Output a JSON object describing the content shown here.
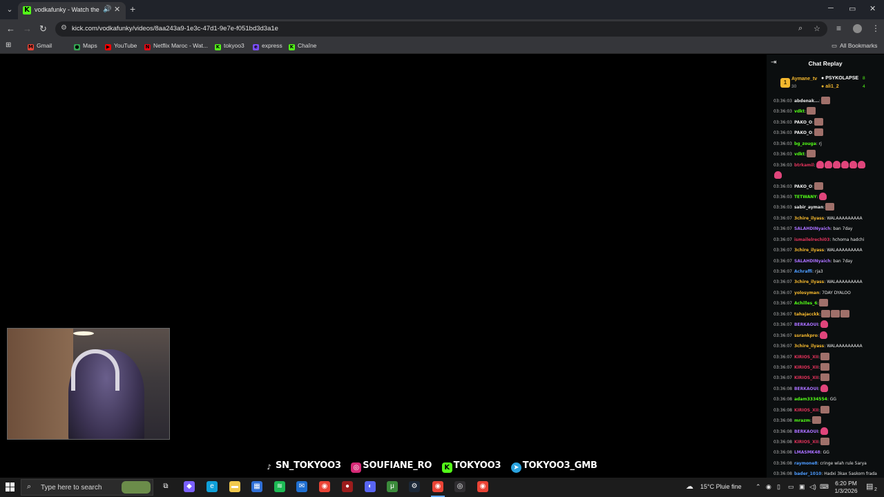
{
  "tab": {
    "title": "vodkafunky - Watch the VO",
    "close": "✕",
    "new_tab": "+"
  },
  "window": {
    "minimize": "─",
    "maximize": "▭",
    "close": "✕"
  },
  "address": {
    "url": "kick.com/vodkafunky/videos/8aa243a9-1e3c-47d1-9e7e-f051bd3d3a1e"
  },
  "bookmarks": {
    "items": [
      {
        "label": "Gmail",
        "color": "#ea4335",
        "glyph": "M"
      },
      {
        "label": "Maps",
        "color": "#34a853",
        "glyph": "●"
      },
      {
        "label": "YouTube",
        "color": "#ff0000",
        "glyph": "▶"
      },
      {
        "label": "Netflix Maroc - Wat...",
        "color": "#e50914",
        "glyph": "N"
      },
      {
        "label": "tokyoo3",
        "color": "#53fc18",
        "glyph": "K"
      },
      {
        "label": "express",
        "color": "#7b4dff",
        "glyph": "e"
      },
      {
        "label": "Chaîne",
        "color": "#53fc18",
        "glyph": "K"
      }
    ],
    "all": "All Bookmarks"
  },
  "overlay": {
    "socials": [
      {
        "label": "SN_TOKYOO3",
        "color": "#000000",
        "glyph": "♪"
      },
      {
        "label": "SOUFIANE_RO",
        "color": "#d62976",
        "glyph": "◎"
      },
      {
        "label": "TOKYOO3",
        "color": "#53fc18",
        "glyph": "K"
      },
      {
        "label": "TOKYOO3_GMB",
        "color": "#2aa3df",
        "glyph": "➤"
      }
    ]
  },
  "chat": {
    "title": "Chat Replay",
    "leaderboard": [
      {
        "rank": "1",
        "name": "Aymane_tv",
        "count": "30",
        "color": "#f5b82e"
      },
      {
        "name": "PSYKOLAPSE",
        "count": "8",
        "color": "#ffffff"
      },
      {
        "name": "ali1_2",
        "count": "4",
        "color": "#f5b82e"
      }
    ],
    "messages": [
      {
        "time": "03:36:03",
        "user": "abdenak...",
        "color": "#e8e8e8",
        "text": ":",
        "emotes": 1,
        "emote_type": "face"
      },
      {
        "time": "03:36:03",
        "user": "vdkt",
        "color": "#53fc18",
        "text": ":",
        "emotes": 1,
        "emote_type": "face"
      },
      {
        "time": "03:36:03",
        "user": "PAKO_O",
        "color": "#e8e8e8",
        "text": ":",
        "emotes": 1,
        "emote_type": "face"
      },
      {
        "time": "03:36:03",
        "user": "PAKO_O",
        "color": "#e8e8e8",
        "text": ":",
        "emotes": 1,
        "emote_type": "face"
      },
      {
        "time": "03:36:03",
        "user": "bg_zouga",
        "color": "#53fc18",
        "text": ": rj",
        "emotes": 0,
        "emote_type": "face"
      },
      {
        "time": "03:36:03",
        "user": "vdkt",
        "color": "#53fc18",
        "text": ":",
        "emotes": 1,
        "emote_type": "face"
      },
      {
        "time": "03:36:03",
        "user": "btrkamil",
        "color": "#e0325a",
        "text": ":",
        "emotes": 6,
        "emote_type": "pink"
      },
      {
        "time": "",
        "user": "",
        "color": "#e8e8e8",
        "text": "",
        "emotes": 1,
        "emote_type": "pink"
      },
      {
        "time": "03:36:03",
        "user": "PAKO_O",
        "color": "#e8e8e8",
        "text": ":",
        "emotes": 1,
        "emote_type": "face"
      },
      {
        "time": "03:36:03",
        "user": "TETWANY",
        "color": "#53fc18",
        "text": ":",
        "emotes": 1,
        "emote_type": "pink"
      },
      {
        "time": "03:36:03",
        "user": "sabir_ayman",
        "color": "#e8e8e8",
        "text": ":",
        "emotes": 1,
        "emote_type": "face"
      },
      {
        "time": "03:36:07",
        "user": "3chire_ilyass",
        "color": "#f5b82e",
        "text": ": WALAAAAAAAAA",
        "emotes": 0,
        "emote_type": "face"
      },
      {
        "time": "03:36:07",
        "user": "SALAHDINyaich",
        "color": "#a970ff",
        "text": ": ban 7day",
        "emotes": 0,
        "emote_type": "face"
      },
      {
        "time": "03:36:07",
        "user": "ismailelrechi03",
        "color": "#e0325a",
        "text": ": hchoma hadchi",
        "emotes": 0,
        "emote_type": "face"
      },
      {
        "time": "03:36:07",
        "user": "3chire_ilyass",
        "color": "#f5b82e",
        "text": ": WALAAAAAAAAA",
        "emotes": 0,
        "emote_type": "face"
      },
      {
        "time": "03:36:07",
        "user": "SALAHDINyaich",
        "color": "#a970ff",
        "text": ": ban 7day",
        "emotes": 0,
        "emote_type": "face"
      },
      {
        "time": "03:36:07",
        "user": "Achraffi",
        "color": "#4d9bff",
        "text": ": rja3",
        "emotes": 0,
        "emote_type": "face"
      },
      {
        "time": "03:36:07",
        "user": "3chire_ilyass",
        "color": "#f5b82e",
        "text": ": WALAAAAAAAAA",
        "emotes": 0,
        "emote_type": "face"
      },
      {
        "time": "03:36:07",
        "user": "yolosyman",
        "color": "#f5b82e",
        "text": ": 7DAY DYALOO",
        "emotes": 0,
        "emote_type": "face"
      },
      {
        "time": "03:36:07",
        "user": "Achilles_6",
        "color": "#53fc18",
        "text": ":",
        "emotes": 1,
        "emote_type": "face"
      },
      {
        "time": "03:36:07",
        "user": "tahajacckk",
        "color": "#f5b82e",
        "text": ":",
        "emotes": 3,
        "emote_type": "face"
      },
      {
        "time": "03:36:07",
        "user": "BERKAOUI",
        "color": "#a970ff",
        "text": ":",
        "emotes": 1,
        "emote_type": "pink"
      },
      {
        "time": "03:36:07",
        "user": "ssrankpro",
        "color": "#f5b82e",
        "text": ":",
        "emotes": 1,
        "emote_type": "pink"
      },
      {
        "time": "03:36:07",
        "user": "3chire_ilyass",
        "color": "#f5b82e",
        "text": ": WALAAAAAAAAA",
        "emotes": 0,
        "emote_type": "face"
      },
      {
        "time": "03:36:07",
        "user": "KIRIOS_XII",
        "color": "#e0325a",
        "text": ":",
        "emotes": 1,
        "emote_type": "face"
      },
      {
        "time": "03:36:07",
        "user": "KIRIOS_XII",
        "color": "#e0325a",
        "text": ":",
        "emotes": 1,
        "emote_type": "face"
      },
      {
        "time": "03:36:07",
        "user": "KIRIOS_XII",
        "color": "#e0325a",
        "text": ":",
        "emotes": 1,
        "emote_type": "face"
      },
      {
        "time": "03:36:08",
        "user": "BERKAOUI",
        "color": "#a970ff",
        "text": ":",
        "emotes": 1,
        "emote_type": "pink"
      },
      {
        "time": "03:36:08",
        "user": "adam3334554",
        "color": "#53fc18",
        "text": ": GG",
        "emotes": 0,
        "emote_type": "face"
      },
      {
        "time": "03:36:08",
        "user": "KIRIOS_XII",
        "color": "#e0325a",
        "text": ":",
        "emotes": 1,
        "emote_type": "face"
      },
      {
        "time": "03:36:08",
        "user": "mrazm",
        "color": "#53fc18",
        "text": ":",
        "emotes": 1,
        "emote_type": "face"
      },
      {
        "time": "03:36:08",
        "user": "BERKAOUI",
        "color": "#a970ff",
        "text": ":",
        "emotes": 1,
        "emote_type": "pink"
      },
      {
        "time": "03:36:08",
        "user": "KIRIOS_XII",
        "color": "#e0325a",
        "text": ":",
        "emotes": 1,
        "emote_type": "face"
      },
      {
        "time": "03:36:08",
        "user": "LMASMK48",
        "color": "#a970ff",
        "text": ": GG",
        "emotes": 0,
        "emote_type": "face"
      },
      {
        "time": "03:36:08",
        "user": "raymone8",
        "color": "#4d9bff",
        "text": ": cringe wlah rule 5arya",
        "emotes": 0,
        "emote_type": "face"
      },
      {
        "time": "03:36:08",
        "user": "bader_1010",
        "color": "#4d9bff",
        "text": ": Hadxi 3kax 5askom frada",
        "emotes": 0,
        "emote_type": "face"
      }
    ]
  },
  "taskbar": {
    "search_placeholder": "Type here to search",
    "weather": "15°C  Pluie fine",
    "time": "6:20 PM",
    "date": "1/3/2026",
    "notification_count": "2",
    "apps": [
      {
        "name": "task-view-icon",
        "color": "#1c1c1c",
        "glyph": "⧉"
      },
      {
        "name": "copilot-icon",
        "color": "#7b61ff",
        "glyph": "◆"
      },
      {
        "name": "edge-icon",
        "color": "#0fa0d9",
        "glyph": "e"
      },
      {
        "name": "file-explorer-icon",
        "color": "#f2c94c",
        "glyph": "▬"
      },
      {
        "name": "store-icon",
        "color": "#2f6fd6",
        "glyph": "▦"
      },
      {
        "name": "spotify-icon",
        "color": "#1db954",
        "glyph": "≋"
      },
      {
        "name": "mail-icon",
        "color": "#1f6fd1",
        "glyph": "✉"
      },
      {
        "name": "chrome-icon",
        "color": "#ea4335",
        "glyph": "◉"
      },
      {
        "name": "app-red-icon",
        "color": "#9b1c1c",
        "glyph": "●"
      },
      {
        "name": "discord-icon",
        "color": "#5865f2",
        "glyph": "◐"
      },
      {
        "name": "utorrent-icon",
        "color": "#3b8b3b",
        "glyph": "μ"
      },
      {
        "name": "steam-icon",
        "color": "#1b2838",
        "glyph": "⚙"
      },
      {
        "name": "chrome-active-icon",
        "color": "#ea4335",
        "glyph": "◉"
      },
      {
        "name": "obs-icon",
        "color": "#302e31",
        "glyph": "◎"
      },
      {
        "name": "chrome-profile-icon",
        "color": "#ea4335",
        "glyph": "◉"
      }
    ]
  }
}
